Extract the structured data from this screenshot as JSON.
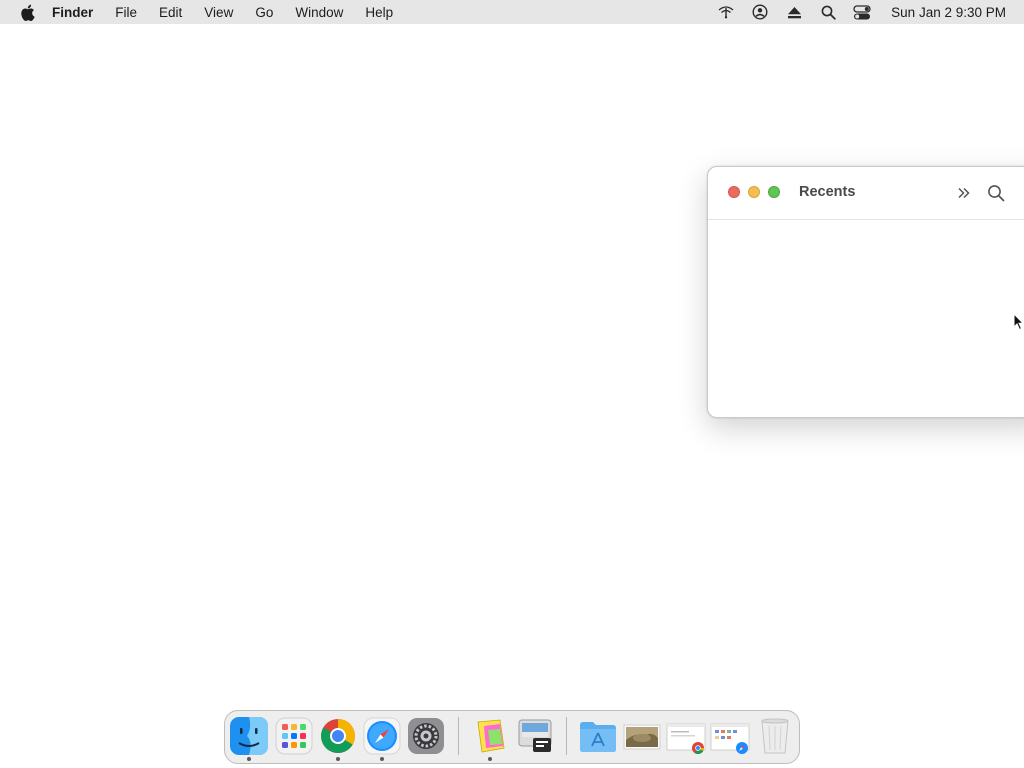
{
  "menubar": {
    "app_name": "Finder",
    "items": [
      "File",
      "Edit",
      "View",
      "Go",
      "Window",
      "Help"
    ],
    "status_icons": [
      "wifi-off-icon",
      "user-icon",
      "eject-icon",
      "search-icon",
      "control-center-icon"
    ],
    "clock": "Sun Jan 2  9:30 PM"
  },
  "window": {
    "title": "Recents",
    "tools": [
      "chevron-double-right-icon",
      "search-icon"
    ]
  },
  "dock": {
    "apps": [
      {
        "name": "finder-icon",
        "running": true
      },
      {
        "name": "launchpad-icon",
        "running": false
      },
      {
        "name": "chrome-icon",
        "running": true
      },
      {
        "name": "safari-icon",
        "running": true
      },
      {
        "name": "system-settings-icon",
        "running": false
      },
      {
        "name": "color-app-icon",
        "running": true
      },
      {
        "name": "preview-app-icon",
        "running": false
      },
      {
        "name": "applications-folder-icon",
        "running": false
      },
      {
        "name": "photo-thumbnail-icon",
        "running": false
      },
      {
        "name": "document-chrome-icon",
        "running": false
      },
      {
        "name": "document-safari-icon",
        "running": false
      },
      {
        "name": "trash-icon",
        "running": false
      }
    ]
  },
  "colors": {
    "menubar_bg": "#e6e6e6",
    "close": "#ed6a5e",
    "minimize": "#f5bf4f",
    "maximize": "#61c554"
  }
}
